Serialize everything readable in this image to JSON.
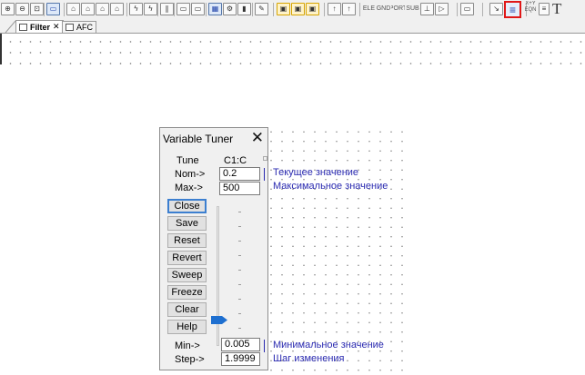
{
  "toolbar": {
    "buttons": [
      {
        "name": "zoom-in-icon",
        "glyph": "⊕"
      },
      {
        "name": "zoom-out-icon",
        "glyph": "⊖"
      },
      {
        "name": "zoom-fit-icon",
        "glyph": "⊡"
      },
      {
        "name": "open-icon",
        "glyph": "▭"
      },
      {
        "name": "part-icon",
        "glyph": "⌂"
      },
      {
        "name": "part-icon-2",
        "glyph": "⌂"
      },
      {
        "name": "part-icon-3",
        "glyph": "⌂"
      },
      {
        "name": "part-icon-4",
        "glyph": "⌂"
      },
      {
        "name": "flash-icon",
        "glyph": "ϟ"
      },
      {
        "name": "flash-icon-2",
        "glyph": "ϟ"
      },
      {
        "name": "pause-icon",
        "glyph": "∥"
      },
      {
        "name": "window-icon",
        "glyph": "▭"
      },
      {
        "name": "window-icon-2",
        "glyph": "▭"
      },
      {
        "name": "grid-icon",
        "glyph": "▦"
      },
      {
        "name": "network-icon",
        "glyph": "⚙"
      },
      {
        "name": "component-icon",
        "glyph": "▮"
      },
      {
        "name": "tune-icon",
        "glyph": "✎"
      },
      {
        "name": "layout-icon",
        "glyph": "▣"
      },
      {
        "name": "layout-icon-2",
        "glyph": "▣"
      },
      {
        "name": "layout-icon-3",
        "glyph": "▣"
      },
      {
        "name": "up-icon",
        "glyph": "↑"
      },
      {
        "name": "up-icon-2",
        "glyph": "↑"
      },
      {
        "name": "ele-icon",
        "glyph": "ELE"
      },
      {
        "name": "gnd-icon",
        "glyph": "GND"
      },
      {
        "name": "port-icon",
        "glyph": "PORT"
      },
      {
        "name": "sub-icon",
        "glyph": "SUB"
      },
      {
        "name": "probe-icon",
        "glyph": "⊥"
      },
      {
        "name": "arrow-icon",
        "glyph": "▷"
      },
      {
        "name": "measure-icon",
        "glyph": "▭"
      },
      {
        "name": "wire-icon",
        "glyph": "↘"
      }
    ],
    "highlighted_glyph": "≡",
    "xy_label": "X+Y",
    "eqn_label": "EQN",
    "big_t": "T",
    "arrow_color": "#e01818"
  },
  "tabs": [
    {
      "label": "Filter",
      "close": "✕",
      "selected": true
    },
    {
      "label": "AFC",
      "close": "",
      "selected": false
    }
  ],
  "tuner": {
    "title": "Variable Tuner",
    "close": "✕",
    "col_tune": "Tune",
    "col_var": "C1:C",
    "nom_label": "Nom->",
    "nom_value": "0.2",
    "max_label": "Max->",
    "max_value": "500",
    "min_label": "Min->",
    "min_value": "0.005",
    "step_label": "Step->",
    "step_value": "1.9999",
    "buttons": [
      "Close",
      "Save",
      "Reset",
      "Revert",
      "Sweep",
      "Freeze",
      "Clear",
      "Help"
    ],
    "slider_color": "#1e6fd0"
  },
  "notes": {
    "current": "Текущее значение",
    "maximum": "Максимальное значение",
    "minimum": "Минимальное значение",
    "step": "Шаг изменения",
    "color": "#2a2ab0"
  }
}
